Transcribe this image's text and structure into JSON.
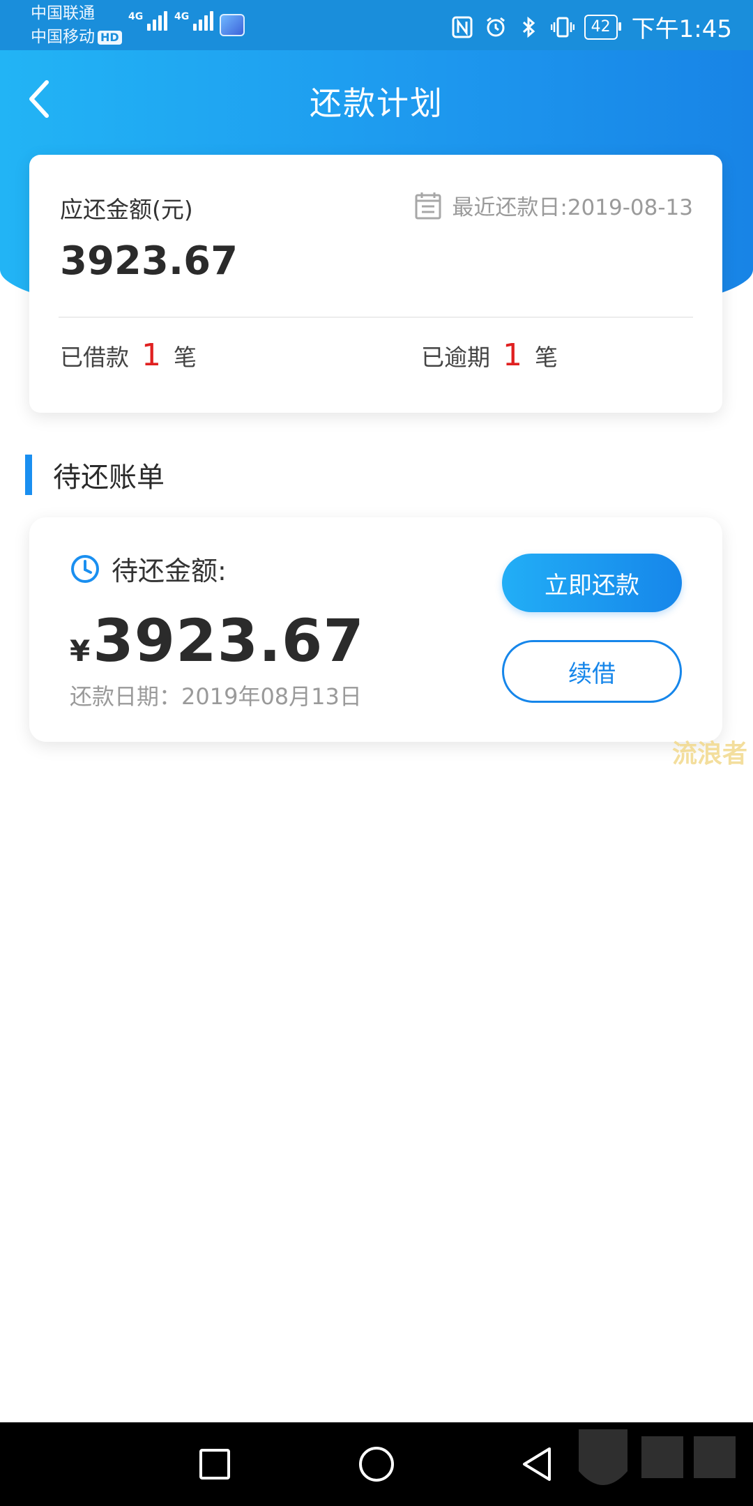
{
  "status_bar": {
    "carrier_1": "中国联通",
    "carrier_2": "中国移动",
    "hd_label": "HD",
    "network_1": "4G",
    "network_2": "4G",
    "battery": "42",
    "time": "下午1:45"
  },
  "nav": {
    "title": "还款计划"
  },
  "summary": {
    "amount_label": "应还金额(元)",
    "amount": "3923.67",
    "recent_due": "最近还款日:2019-08-13",
    "borrowed_label": "已借款",
    "borrowed_count": "1",
    "borrowed_unit": "笔",
    "overdue_label": "已逾期",
    "overdue_count": "1",
    "overdue_unit": "笔"
  },
  "section": {
    "title": "待还账单"
  },
  "bill": {
    "label": "待还金额:",
    "currency": "¥",
    "amount": "3923.67",
    "due_date": "还款日期：2019年08月13日",
    "pay_button": "立即还款",
    "renew_button": "续借"
  },
  "watermark": {
    "text": "流浪者"
  },
  "colors": {
    "primary": "#1686ea",
    "accent_red": "#e02020",
    "header_gradient_start": "#22b4f5",
    "header_gradient_end": "#1884e6"
  },
  "icons": {
    "back": "chevron-left-icon",
    "calendar": "calendar-icon",
    "clock": "clock-icon",
    "nfc": "nfc-icon",
    "alarm": "alarm-icon",
    "bluetooth": "bluetooth-icon",
    "vibrate": "vibrate-icon"
  }
}
